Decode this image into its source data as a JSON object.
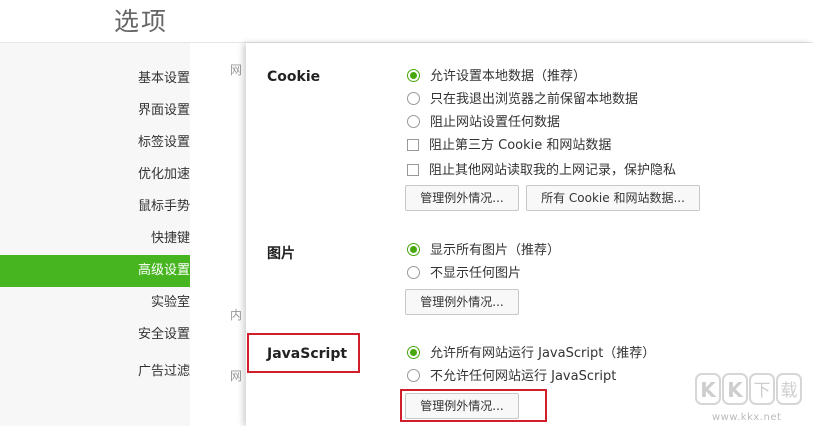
{
  "page": {
    "title": "选项"
  },
  "sidebar": {
    "items": [
      {
        "label": "基本设置"
      },
      {
        "label": "界面设置"
      },
      {
        "label": "标签设置"
      },
      {
        "label": "优化加速"
      },
      {
        "label": "鼠标手势"
      },
      {
        "label": "快捷键"
      },
      {
        "label": "高级设置",
        "active": true
      },
      {
        "label": "实验室"
      },
      {
        "label": "安全设置"
      },
      {
        "label": "广告过滤"
      }
    ]
  },
  "background_fragments": [
    "网",
    "内",
    "网"
  ],
  "cookie": {
    "title": "Cookie",
    "options": [
      "允许设置本地数据（推荐）",
      "只在我退出浏览器之前保留本地数据",
      "阻止网站设置任何数据"
    ],
    "checkboxes": [
      "阻止第三方 Cookie 和网站数据",
      "阻止其他网站读取我的上网记录，保护隐私"
    ],
    "exceptions_button": "管理例外情况...",
    "all_cookies_button": "所有 Cookie 和网站数据..."
  },
  "images": {
    "title": "图片",
    "options": [
      "显示所有图片（推荐）",
      "不显示任何图片"
    ],
    "exceptions_button": "管理例外情况..."
  },
  "javascript": {
    "title": "JavaScript",
    "options": [
      "允许所有网站运行 JavaScript（推荐）",
      "不允许任何网站运行 JavaScript"
    ],
    "exceptions_button": "管理例外情况..."
  },
  "watermark": {
    "logo_text": "KK下载",
    "url": "www.kkx.net"
  },
  "colors": {
    "accent": "#47b520",
    "highlight": "#d21e2b"
  }
}
